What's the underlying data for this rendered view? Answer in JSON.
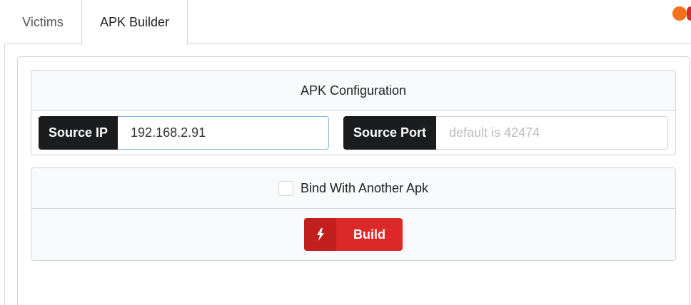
{
  "tabs": [
    {
      "label": "Victims",
      "active": false
    },
    {
      "label": "APK Builder",
      "active": true
    }
  ],
  "status_colors": {
    "orange": "#f2711c",
    "red": "#db2828"
  },
  "config_card": {
    "title": "APK Configuration",
    "source_ip": {
      "label": "Source IP",
      "value": "192.168.2.91",
      "placeholder": ""
    },
    "source_port": {
      "label": "Source Port",
      "value": "",
      "placeholder": "default is 42474"
    }
  },
  "bind_card": {
    "checkbox_label": "Bind With Another Apk",
    "checked": false,
    "build_button": {
      "label": "Build",
      "icon": "lightning-bolt-icon"
    }
  }
}
